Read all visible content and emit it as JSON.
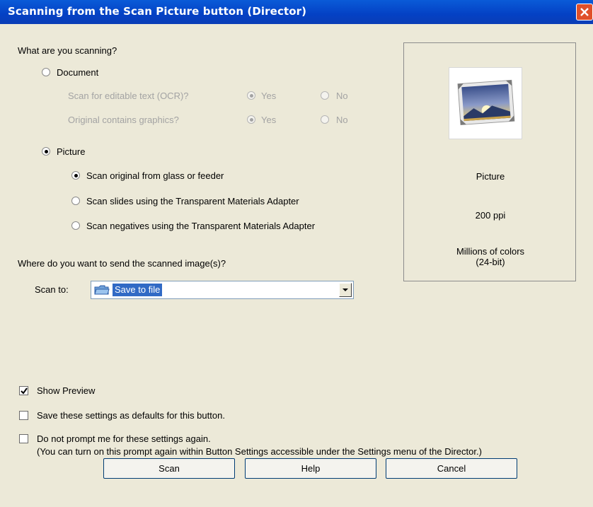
{
  "window": {
    "title": "Scanning from the Scan Picture button (Director)"
  },
  "what_scanning": {
    "heading": "What are you scanning?",
    "document_label": "Document",
    "ocr_label": "Scan for editable text (OCR)?",
    "graphics_label": "Original contains graphics?",
    "yes": "Yes",
    "no": "No",
    "picture_label": "Picture",
    "picture_options": [
      "Scan original from glass or feeder",
      "Scan slides using the Transparent Materials Adapter",
      "Scan negatives using the Transparent Materials Adapter"
    ]
  },
  "destination": {
    "heading": "Where do you want to send the scanned image(s)?",
    "scan_to_label": "Scan to:",
    "scan_to_value": "Save to file"
  },
  "summary": {
    "type": "Picture",
    "resolution": "200 ppi",
    "colors_line1": "Millions of colors",
    "colors_line2": "(24-bit)"
  },
  "options": {
    "show_preview": "Show Preview",
    "save_defaults": "Save these settings as defaults for this button.",
    "no_prompt": "Do not prompt me for these settings again.",
    "no_prompt_note": "(You can turn on this prompt again within Button Settings accessible under the Settings menu of the Director.)"
  },
  "buttons": {
    "scan": "Scan",
    "help": "Help",
    "cancel": "Cancel"
  }
}
